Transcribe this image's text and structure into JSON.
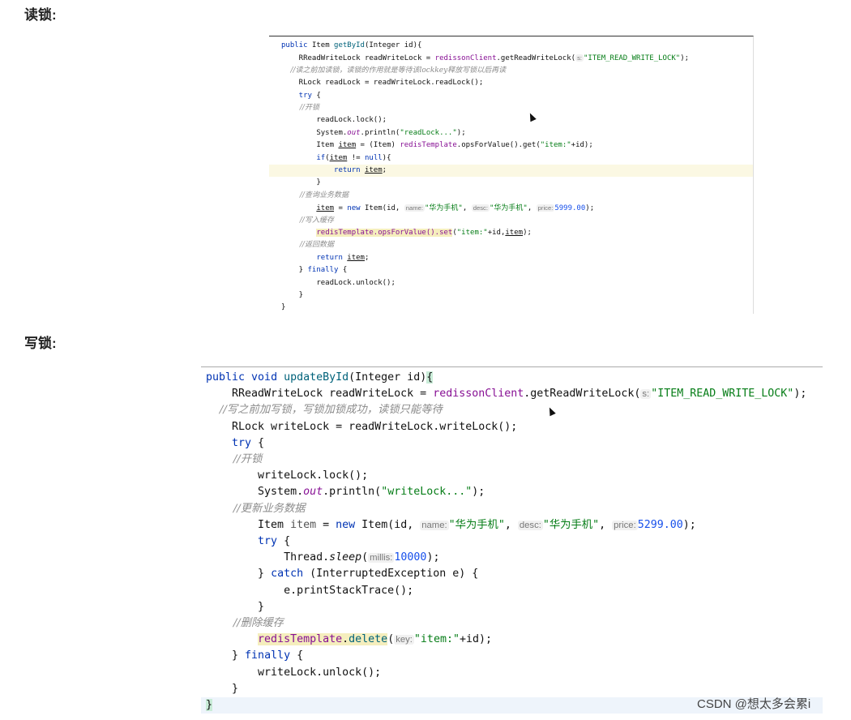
{
  "headings": {
    "read_lock": "读锁:",
    "write_lock": "写锁:"
  },
  "read_code": {
    "l1a": "public ",
    "l1b": "Item ",
    "l1c": "getById",
    "l1d": "(Integer id){",
    "l2a": "    RReadWriteLock readWriteLock = ",
    "l2b": "redissonClient",
    "l2c": ".getReadWriteLock(",
    "l2h": "s:",
    "l2s": "\"ITEM_READ_WRITE_LOCK\"",
    "l2e": ");",
    "l3": "    //读之前加读锁，读锁的作用就是等待该lockkey释放写锁以后再读",
    "l4": "    RLock readLock = readWriteLock.readLock();",
    "l5a": "    try",
    "l5b": " {",
    "l6": "        //开锁",
    "l7": "        readLock.lock();",
    "l8a": "        System.",
    "l8b": "out",
    "l8c": ".println(",
    "l8s": "\"readLock...\"",
    "l8e": ");",
    "l9a": "        Item ",
    "l9b": "item",
    "l9c": " = (Item) ",
    "l9d": "redisTemplate",
    "l9e": ".opsForValue().get(",
    "l9s": "\"item:\"",
    "l9f": "+id);",
    "l10a": "        if",
    "l10b": "(",
    "l10c": "item",
    "l10d": " != ",
    "l10e": "null",
    "l10f": "){",
    "l11a": "            return ",
    "l11b": "item",
    "l11c": ";",
    "l12": "        }",
    "l13": "        //查询业务数据",
    "l14a": "        ",
    "l14b": "item",
    "l14c": " = ",
    "l14d": "new",
    "l14e": " Item(id, ",
    "l14h1": "name:",
    "l14s1": "\"华为手机\"",
    "l14g": ", ",
    "l14h2": "desc:",
    "l14s2": "\"华为手机\"",
    "l14i": ", ",
    "l14h3": "price:",
    "l14n": "5999.00",
    "l14e2": ");",
    "l15": "        //写入缓存",
    "l16a": "        ",
    "l16b": "redisTemplate.opsForValue().set",
    "l16c": "(",
    "l16s": "\"item:\"",
    "l16d": "+id,",
    "l16e": "item",
    "l16f": ");",
    "l17": "        //返回数据",
    "l18a": "        return ",
    "l18b": "item",
    "l18c": ";",
    "l19a": "    } ",
    "l19b": "finally",
    "l19c": " {",
    "l20": "        readLock.unlock();",
    "l21": "    }",
    "l22": "}"
  },
  "write_code": {
    "l1a": "public ",
    "l1b": "void ",
    "l1c": "updateById",
    "l1d": "(Integer id)",
    "l1e": "{",
    "l2a": "    RReadWriteLock readWriteLock = ",
    "l2b": "redissonClient",
    "l2c": ".getReadWriteLock(",
    "l2h": "s:",
    "l2s": "\"ITEM_READ_WRITE_LOCK\"",
    "l2e": ");",
    "l3": "    //写之前加写锁，写锁加锁成功，读锁只能等待",
    "l4": "    RLock writeLock = readWriteLock.writeLock();",
    "l5a": "    try",
    "l5b": " {",
    "l6": "        //开锁",
    "l7": "        writeLock.lock();",
    "l8a": "        System.",
    "l8b": "out",
    "l8c": ".println(",
    "l8s": "\"writeLock...\"",
    "l8e": ");",
    "l9": "        //更新业务数据",
    "l10a": "        Item ",
    "l10b": "item",
    "l10c": " = ",
    "l10d": "new",
    "l10e": " Item(id, ",
    "l10h1": "name:",
    "l10s1": "\"华为手机\"",
    "l10g": ", ",
    "l10h2": "desc:",
    "l10s2": "\"华为手机\"",
    "l10i": ", ",
    "l10h3": "price:",
    "l10n": "5299.00",
    "l10e2": ");",
    "l11a": "        try",
    "l11b": " {",
    "l12a": "            Thread.",
    "l12b": "sleep",
    "l12c": "(",
    "l12h": "millis:",
    "l12n": "10000",
    "l12d": ");",
    "l13a": "        } ",
    "l13b": "catch",
    "l13c": " (InterruptedException e) {",
    "l14": "            e.printStackTrace();",
    "l15": "        }",
    "l16": "        //删除缓存",
    "l17a": "        ",
    "l17b": "redisTemplate",
    "l17c": ".",
    "l17d": "delete",
    "l17e": "(",
    "l17h": "key:",
    "l17s": "\"item:\"",
    "l17f": "+id);",
    "l18a": "    } ",
    "l18b": "finally",
    "l18c": " {",
    "l19": "        writeLock.unlock();",
    "l20": "    }",
    "l21": "}"
  },
  "watermark": "CSDN @想太多会累i"
}
